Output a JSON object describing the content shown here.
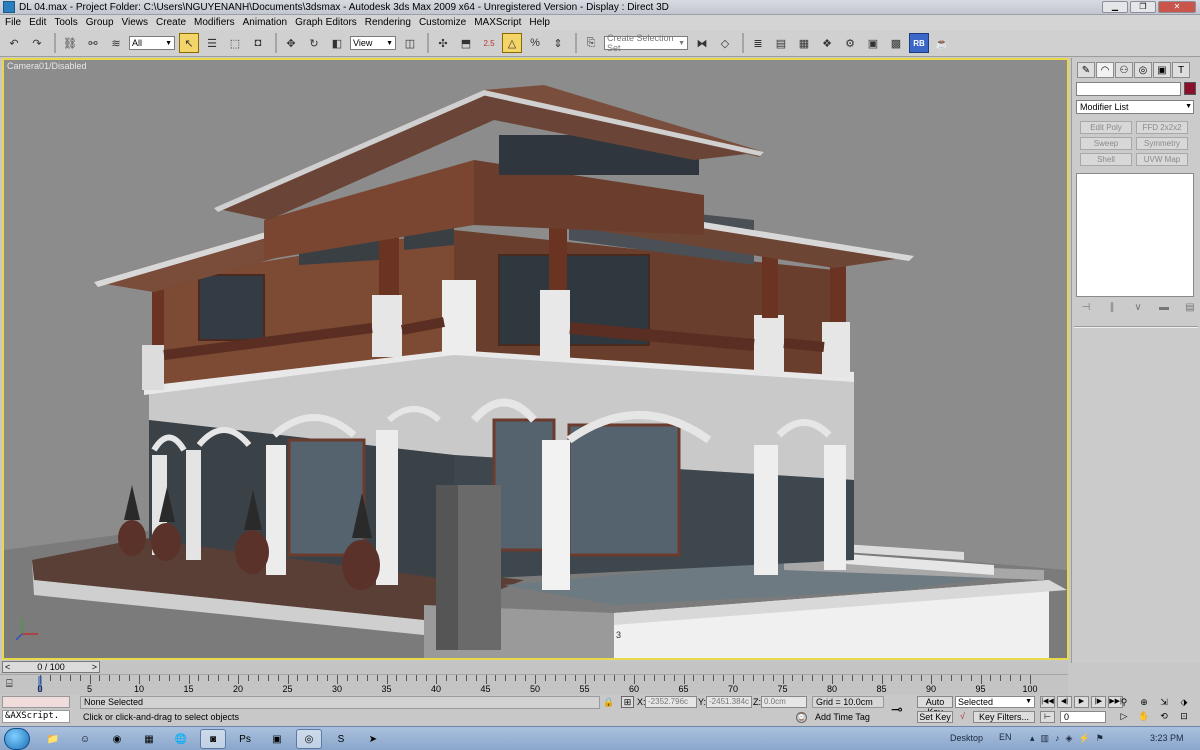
{
  "window": {
    "title": "DL 04.max    - Project Folder: C:\\Users\\NGUYENANH\\Documents\\3dsmax    - Autodesk 3ds Max  2009 x64    - Unregistered Version    - Display : Direct 3D"
  },
  "menu": [
    "File",
    "Edit",
    "Tools",
    "Group",
    "Views",
    "Create",
    "Modifiers",
    "Animation",
    "Graph Editors",
    "Rendering",
    "Customize",
    "MAXScript",
    "Help"
  ],
  "toolbar": {
    "selection_filter": "All",
    "ref_coord": "View",
    "selection_set_placeholder": "Create Selection Set",
    "snap_label": "2.5",
    "rb_label": "RB"
  },
  "viewport": {
    "label": "Camera01/Disabled",
    "active_border_color": "#e8d84a",
    "marker": "3"
  },
  "command_panel": {
    "object_color": "#8b0e2a",
    "modifier_list": "Modifier List",
    "modifier_buttons": [
      "Edit Poly",
      "FFD 2x2x2",
      "Sweep",
      "Symmetry",
      "Shell",
      "UVW Map"
    ]
  },
  "timeline": {
    "slider_text": "0 / 100",
    "ticks": [
      "0",
      "5",
      "10",
      "15",
      "20",
      "25",
      "30",
      "35",
      "40",
      "45",
      "50",
      "55",
      "60",
      "65",
      "70",
      "75",
      "80",
      "85",
      "90",
      "95",
      "100"
    ]
  },
  "status": {
    "maxscript_label": "&AXScript.",
    "selection": "None Selected",
    "prompt": "Click or click-and-drag to select objects",
    "x_label": "X:",
    "x_value": "-2352.796c",
    "y_label": "Y:",
    "y_value": "-2451.384c",
    "z_label": "Z:",
    "z_value": "0.0cm",
    "grid": "Grid = 10.0cm",
    "add_time_tag": "Add Time Tag",
    "auto_key": "Auto Key",
    "set_key": "Set Key",
    "key_mode": "Selected",
    "key_filters": "Key Filters...",
    "current_frame": "0"
  },
  "taskbar": {
    "desktop": "Desktop",
    "lang": "EN",
    "clock": "3:23 PM"
  }
}
